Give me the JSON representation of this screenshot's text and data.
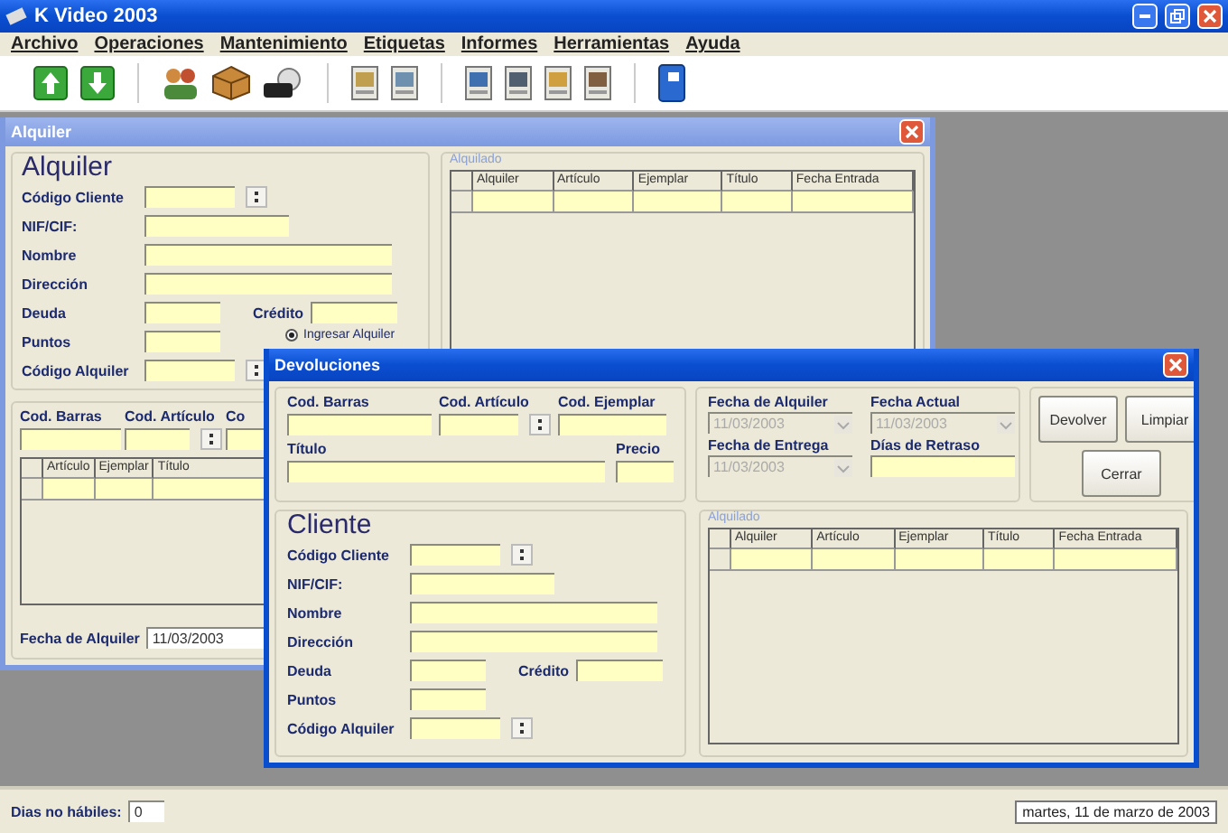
{
  "window": {
    "title": "K Video 2003"
  },
  "menu": [
    "Archivo",
    "Operaciones",
    "Mantenimiento",
    "Etiquetas",
    "Informes",
    "Herramientas",
    "Ayuda"
  ],
  "alquiler": {
    "title": "Alquiler",
    "heading": "Alquiler",
    "rows": [
      {
        "label": "Código Cliente",
        "kind": "lookup"
      },
      {
        "label": "NIF/CIF:",
        "kind": "short"
      },
      {
        "label": "Nombre",
        "kind": "long"
      },
      {
        "label": "Dirección",
        "kind": "long"
      },
      {
        "label": "Deuda",
        "kind": "pair",
        "label_2": "Crédito"
      },
      {
        "label": "Puntos",
        "kind": "tiny"
      },
      {
        "label": "Código Alquiler",
        "kind": "lookup"
      }
    ],
    "radio": {
      "label": "Ingresar Alquiler",
      "selected": true
    },
    "item_fields": [
      {
        "label": "Cod. Barras",
        "kind": "text"
      },
      {
        "label": "Cod. Artículo",
        "kind": "lookup"
      },
      {
        "label": "Co",
        "kind": "text"
      }
    ],
    "item_columns": [
      "Artículo",
      "Ejemplar",
      "Título"
    ],
    "rental_date": {
      "label": "Fecha de Alquiler",
      "value": "11/03/2003"
    },
    "rented": {
      "title": "Alquilado",
      "columns": [
        "Alquiler",
        "Artículo",
        "Ejemplar",
        "Título",
        "Fecha Entrada"
      ]
    }
  },
  "devoluciones": {
    "title": "Devoluciones",
    "item_fields": [
      {
        "label": "Cod. Barras",
        "kind": "text"
      },
      {
        "label": "Cod. Artículo",
        "kind": "lookup"
      },
      {
        "label": "Cod. Ejemplar",
        "kind": "text"
      }
    ],
    "title_field": {
      "label": "Título"
    },
    "price_field": {
      "label": "Precio"
    },
    "dates": [
      {
        "label": "Fecha de Alquiler",
        "value": "11/03/2003",
        "kind": "combo",
        "disabled": true
      },
      {
        "label": "Fecha Actual",
        "value": "11/03/2003",
        "kind": "combo",
        "disabled": true
      },
      {
        "label": "Fecha de Entrega",
        "value": "11/03/2003",
        "kind": "combo",
        "disabled": true
      },
      {
        "label": "Días de Retraso",
        "kind": "text",
        "disabled": false
      }
    ],
    "buttons": [
      "Devolver",
      "Limpiar",
      "Cerrar"
    ],
    "client": {
      "heading": "Cliente",
      "rows": [
        {
          "label": "Código Cliente",
          "kind": "lookup"
        },
        {
          "label": "NIF/CIF:",
          "kind": "short"
        },
        {
          "label": "Nombre",
          "kind": "long"
        },
        {
          "label": "Dirección",
          "kind": "long"
        },
        {
          "label": "Deuda",
          "kind": "pair",
          "label_2": "Crédito"
        },
        {
          "label": "Puntos",
          "kind": "tiny"
        },
        {
          "label": "Código Alquiler",
          "kind": "lookup"
        }
      ]
    },
    "rented": {
      "title": "Alquilado",
      "columns": [
        "Alquiler",
        "Artículo",
        "Ejemplar",
        "Título",
        "Fecha Entrada"
      ]
    }
  },
  "status_bar": {
    "label": "Dias no hábiles:",
    "value": "0",
    "date": "martes, 11 de marzo de 2003"
  }
}
